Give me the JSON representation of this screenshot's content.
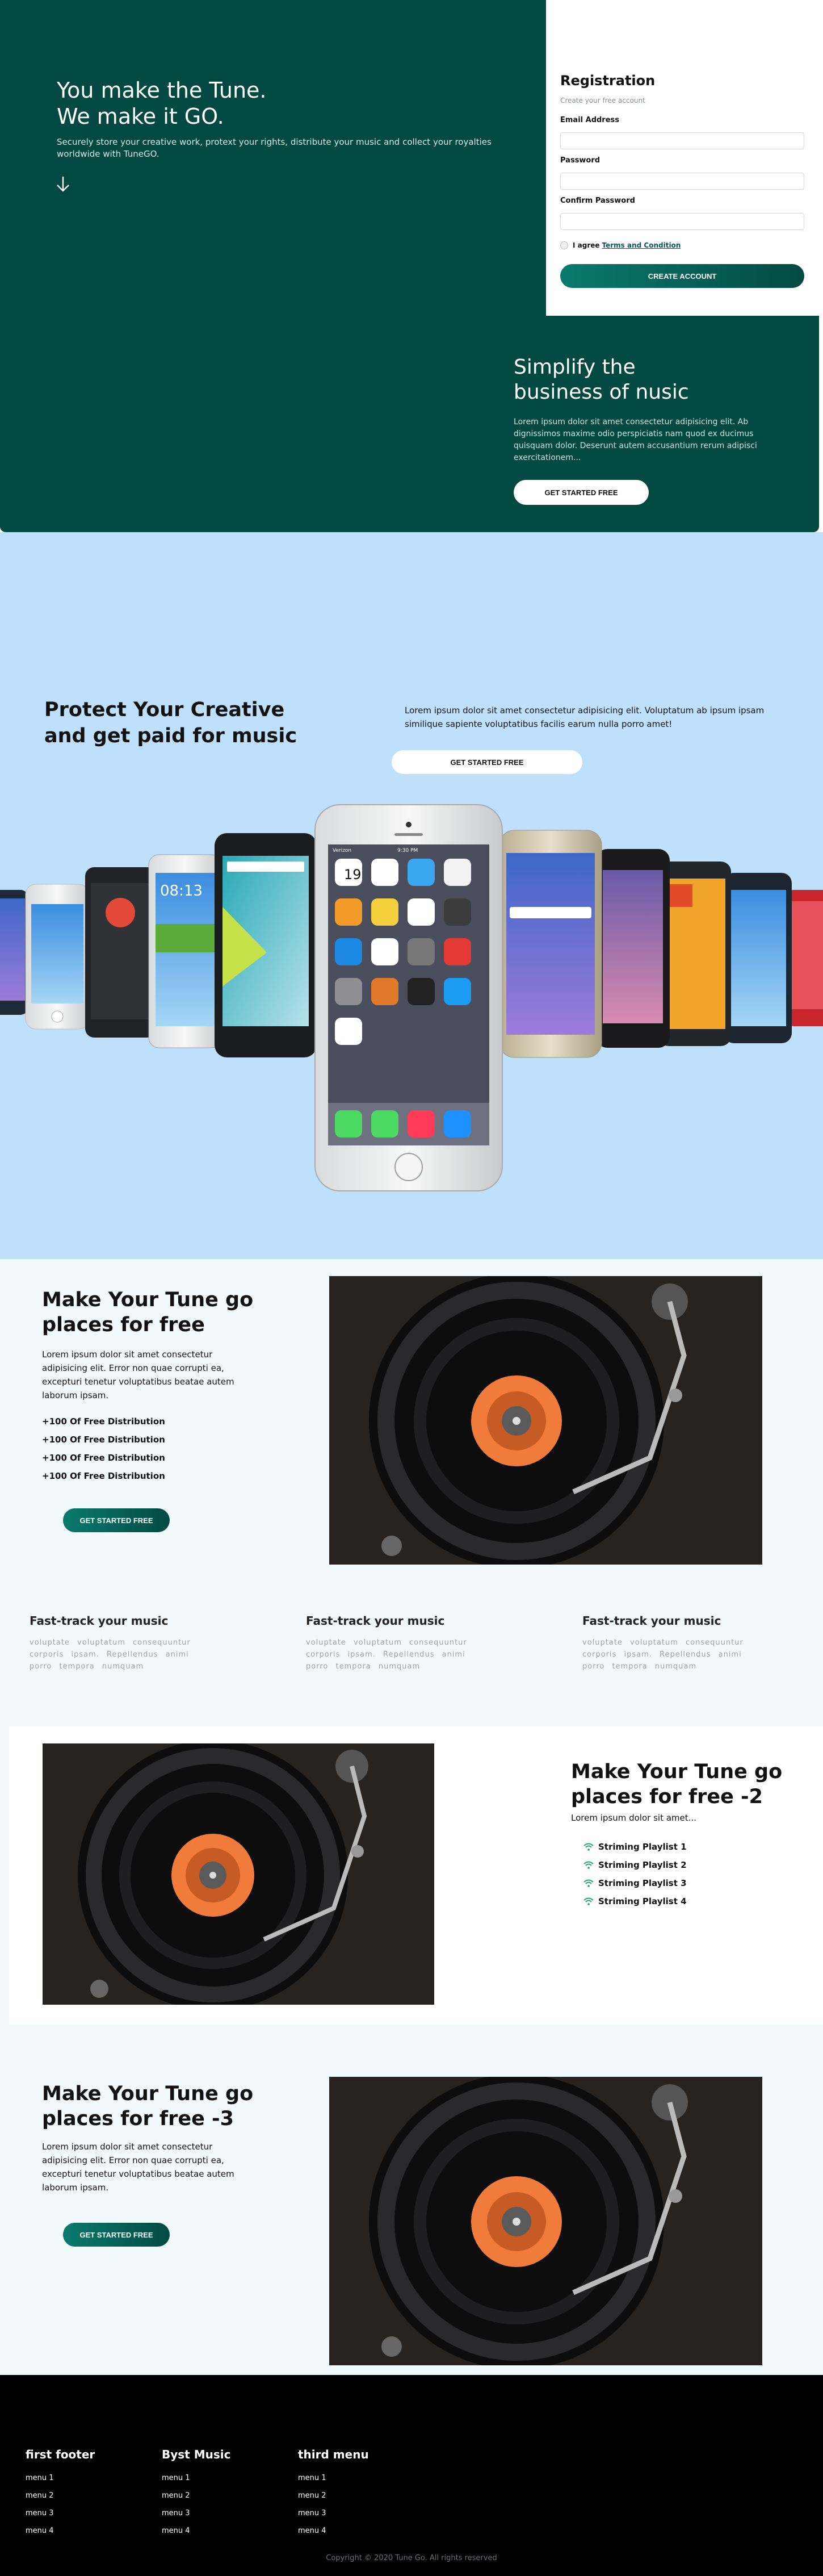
{
  "hero": {
    "title_line1": "You make the Tune.",
    "title_line2": "We make it GO.",
    "description": "Securely store your creative work, protext your rights, distribute your music and collect your royalties worldwide with TuneGO."
  },
  "registration": {
    "title": "Registration",
    "subtitle": "Create your free account",
    "email_label": "Email Address",
    "password_label": "Password",
    "confirm_label": "Confirm Password",
    "agree_text": "I agree",
    "terms_link": "Terms and Condition",
    "submit_label": "CREATE ACCOUNT"
  },
  "simplify": {
    "title_line1": "Simplify the",
    "title_line2": "business of nusic",
    "text": "Lorem ipsum dolor sit amet consectetur adipisicing elit. Ab dignissimos maxime odio perspiciatis nam quod ex ducimus quisquam dolor. Deserunt autem accusantium rerum adipisci exercitationem...",
    "button_label": "GET STARTED FREE"
  },
  "protect": {
    "title_line1": "Protect Your Creative",
    "title_line2": "and get paid for music",
    "text": "Lorem ipsum dolor sit amet consectetur adipisicing elit. Voluptatum ab ipsum ipsam similique sapiente voluptatibus facilis earum nulla porro amet!",
    "button_label": "GET STARTED FREE"
  },
  "feature1": {
    "title_line1": "Make Your Tune go",
    "title_line2": "places for free",
    "text": "Lorem ipsum dolor sit amet consectetur adipisicing elit. Error non quae corrupti ea, excepturi tenetur voluptatibus beatae autem laborum ipsam.",
    "list": [
      "+100 Of Free Distribution",
      "+100 Of Free Distribution",
      "+100 Of Free Distribution",
      "+100 Of Free Distribution"
    ],
    "button_label": "GET STARTED FREE"
  },
  "fast_track": [
    {
      "title": "Fast-track your music",
      "text": "voluptate voluptatum consequuntur corporis ipsam. Repellendus animi porro tempora numquam"
    },
    {
      "title": "Fast-track your music",
      "text": "voluptate voluptatum consequuntur corporis ipsam. Repellendus animi porro tempora numquam"
    },
    {
      "title": "Fast-track your music",
      "text": "voluptate voluptatum consequuntur corporis ipsam. Repellendus animi porro tempora numquam"
    }
  ],
  "feature2": {
    "title_line1": "Make Your Tune go",
    "title_line2": "places for free -2",
    "text": "Lorem ipsum dolor sit amet...",
    "playlists": [
      "Striming Playlist 1",
      "Striming Playlist 2",
      "Striming Playlist 3",
      "Striming Playlist 4"
    ]
  },
  "feature3": {
    "title_line1": "Make Your Tune go",
    "title_line2": "places for free -3",
    "text": "Lorem ipsum dolor sit amet consectetur adipisicing elit. Error non quae corrupti ea, excepturi tenetur voluptatibus beatae autem laborum ipsam.",
    "button_label": "GET STARTED FREE"
  },
  "footer": {
    "columns": [
      {
        "title": "first footer",
        "items": [
          "menu 1",
          "menu 2",
          "menu 3",
          "menu 4"
        ]
      },
      {
        "title": "Byst Music",
        "items": [
          "menu 1",
          "menu 2",
          "menu 3",
          "menu 4"
        ]
      },
      {
        "title": "third menu",
        "items": [
          "menu 1",
          "menu 2",
          "menu 3",
          "menu 4"
        ]
      }
    ],
    "copyright": "Copyright © 2020 Tune Go. All rights reserved"
  },
  "phone_screen": {
    "time": "08:13",
    "date": "19",
    "carrier": "Verizon",
    "clock": "9:30 PM"
  },
  "colors": {
    "primary_dark": "#024a41",
    "primary": "#0a7a6e",
    "light_blue": "#bfe0fb",
    "light_section": "#f2fafd",
    "footer": "#000000"
  },
  "icons": [
    "down-arrow-icon",
    "signal-icon"
  ]
}
